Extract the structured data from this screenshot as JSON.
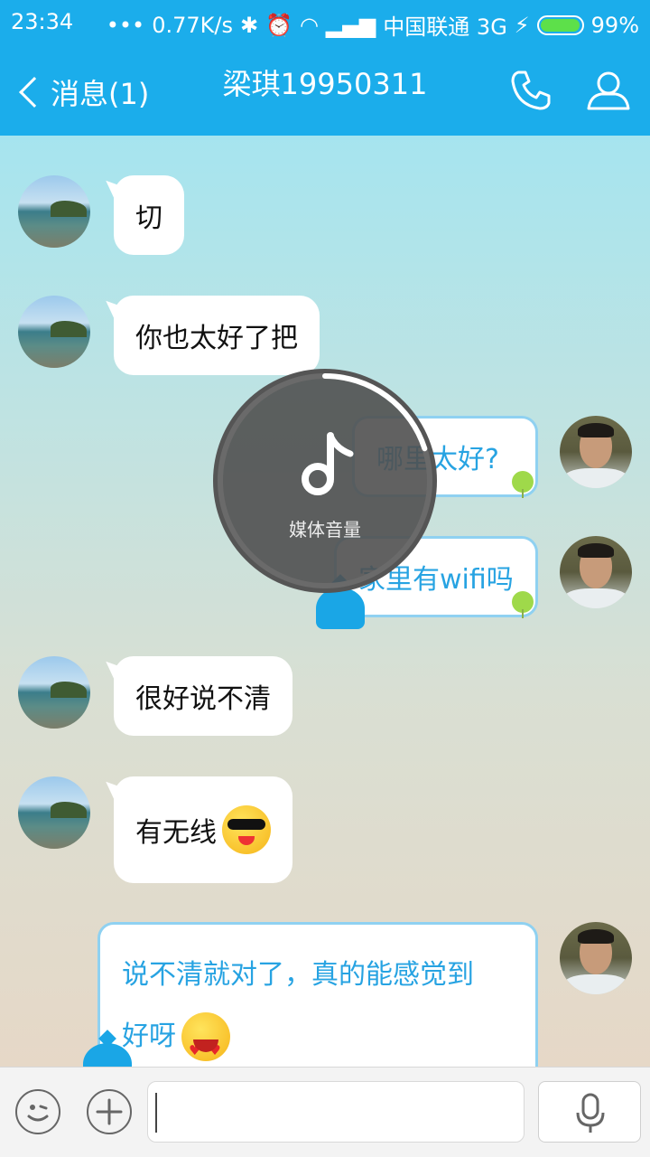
{
  "status_bar": {
    "time": "23:34",
    "network_speed": "0.77K/s",
    "carrier": "中国联通 3G",
    "battery": "99%",
    "battery_level": 0.99
  },
  "header": {
    "back_label": "消息(1)",
    "title": "梁琪19950311",
    "accent_color": "#1badeb"
  },
  "messages": [
    {
      "side": "in",
      "text": "切"
    },
    {
      "side": "in",
      "text": "你也太好了把"
    },
    {
      "side": "out",
      "text": "哪里太好?"
    },
    {
      "side": "out",
      "text": "家里有wifi吗"
    },
    {
      "side": "in",
      "text": "很好说不清"
    },
    {
      "side": "in",
      "text": "有无线",
      "emoji": "sunglasses-emoji"
    },
    {
      "side": "out",
      "text_line1": "说不清就对了，真的能感觉到",
      "text_line2": "好呀",
      "emoji": "heart-eyes-emoji"
    }
  ],
  "volume_overlay": {
    "label": "媒体音量",
    "level": 0.2
  },
  "input": {
    "value": ""
  }
}
